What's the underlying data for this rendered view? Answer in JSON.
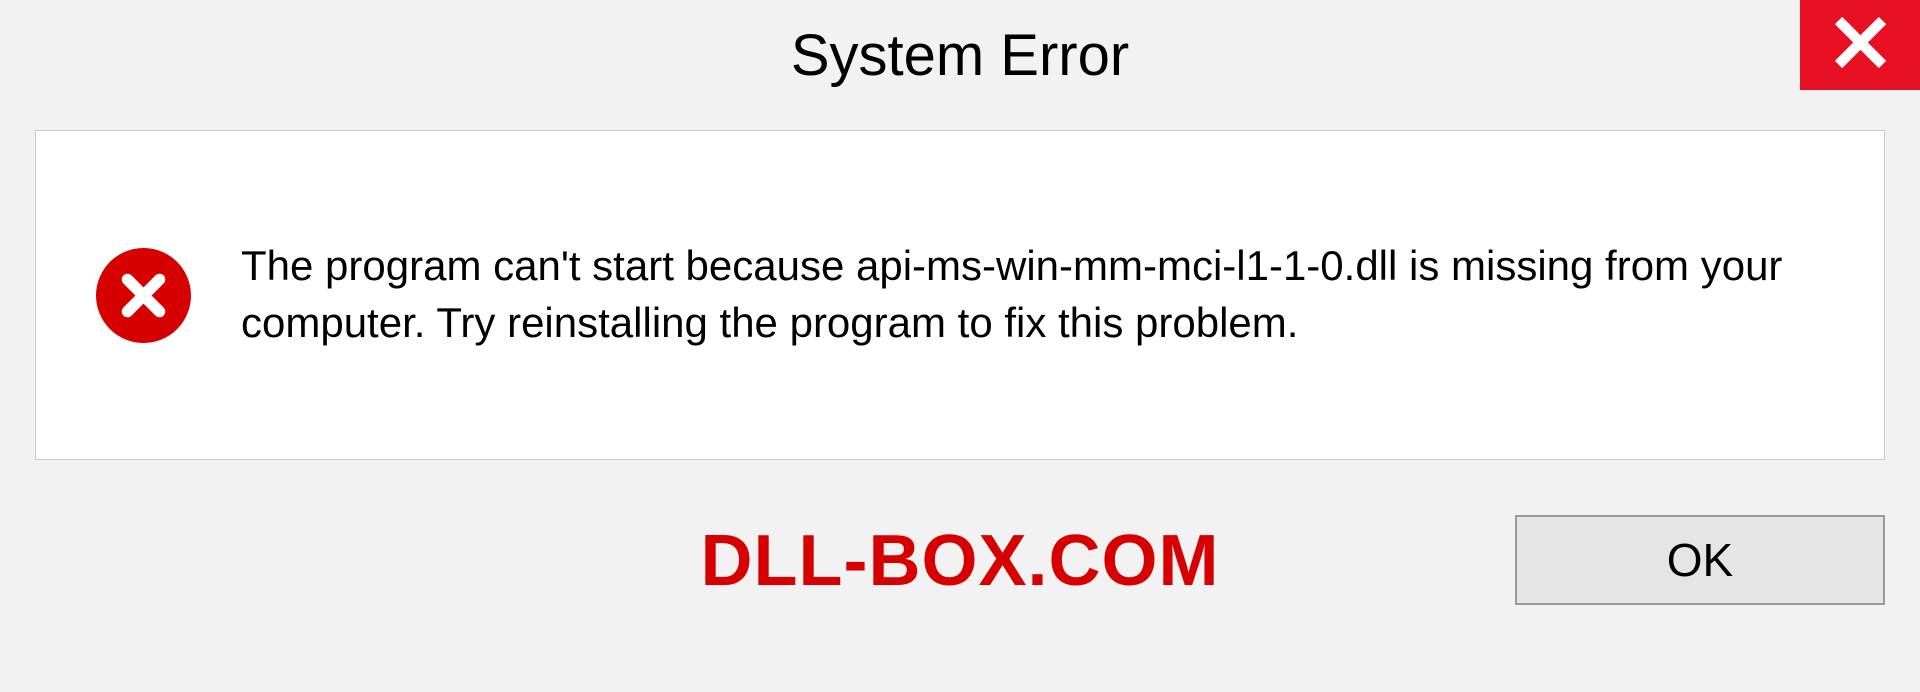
{
  "titlebar": {
    "title": "System Error"
  },
  "content": {
    "message": "The program can't start because api-ms-win-mm-mci-l1-1-0.dll is missing from your computer. Try reinstalling the program to fix this problem."
  },
  "footer": {
    "watermark": "DLL-BOX.COM",
    "ok_label": "OK"
  },
  "colors": {
    "close_bg": "#e81123",
    "error_red": "#d60000",
    "panel_bg": "#ffffff",
    "window_bg": "#f2f2f2"
  }
}
